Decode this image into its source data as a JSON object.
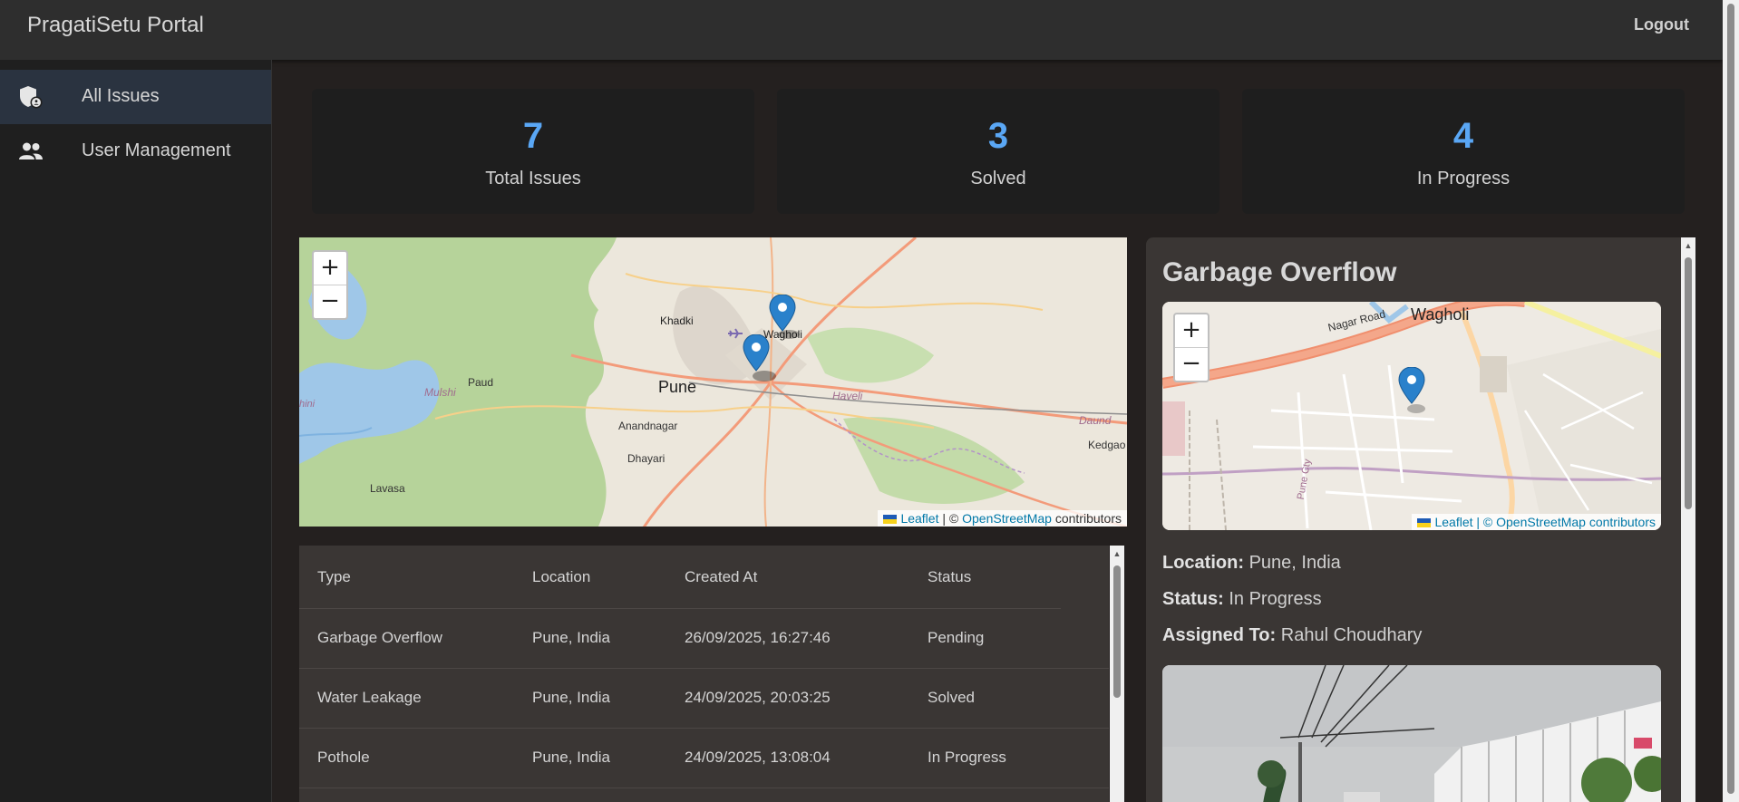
{
  "app": {
    "title": "PragatiSetu Portal",
    "logout_label": "Logout"
  },
  "sidebar": {
    "items": [
      {
        "label": "All Issues",
        "icon": "shield-icon",
        "active": true
      },
      {
        "label": "User Management",
        "icon": "people-icon",
        "active": false
      }
    ]
  },
  "stats": [
    {
      "value": "7",
      "label": "Total Issues"
    },
    {
      "value": "3",
      "label": "Solved"
    },
    {
      "value": "4",
      "label": "In Progress"
    }
  ],
  "overview_map": {
    "places": [
      "Wagholi",
      "Khadki",
      "Pune",
      "Paud",
      "Mulshi",
      "Haveli",
      "Anandnagar",
      "Dhayari",
      "Lavasa",
      "Daund",
      "Kedgao",
      "hini"
    ],
    "marker_count": 2,
    "attribution": {
      "leaflet": "Leaflet",
      "separator": "| ©",
      "osm": "OpenStreetMap",
      "suffix": "contributors"
    }
  },
  "issues_table": {
    "columns": [
      "Type",
      "Location",
      "Created At",
      "Status"
    ],
    "rows": [
      [
        "Garbage Overflow",
        "Pune, India",
        "26/09/2025, 16:27:46",
        "Pending"
      ],
      [
        "Water Leakage",
        "Pune, India",
        "24/09/2025, 20:03:25",
        "Solved"
      ],
      [
        "Pothole",
        "Pune, India",
        "24/09/2025, 13:08:04",
        "In Progress"
      ]
    ]
  },
  "detail": {
    "title": "Garbage Overflow",
    "map": {
      "places": [
        "Wagholi",
        "Nagar Road",
        "Pune Cty"
      ],
      "attribution": "Leaflet | © OpenStreetMap contributors"
    },
    "location_label": "Location:",
    "location": "Pune, India",
    "status_label": "Status:",
    "status": "In Progress",
    "assigned_label": "Assigned To:",
    "assigned": "Rahul Choudhary"
  },
  "colors": {
    "accent": "#5aa7f5",
    "marker": "#2a81cb",
    "topbar": "#2e2e2e",
    "panel": "#3a3634"
  }
}
